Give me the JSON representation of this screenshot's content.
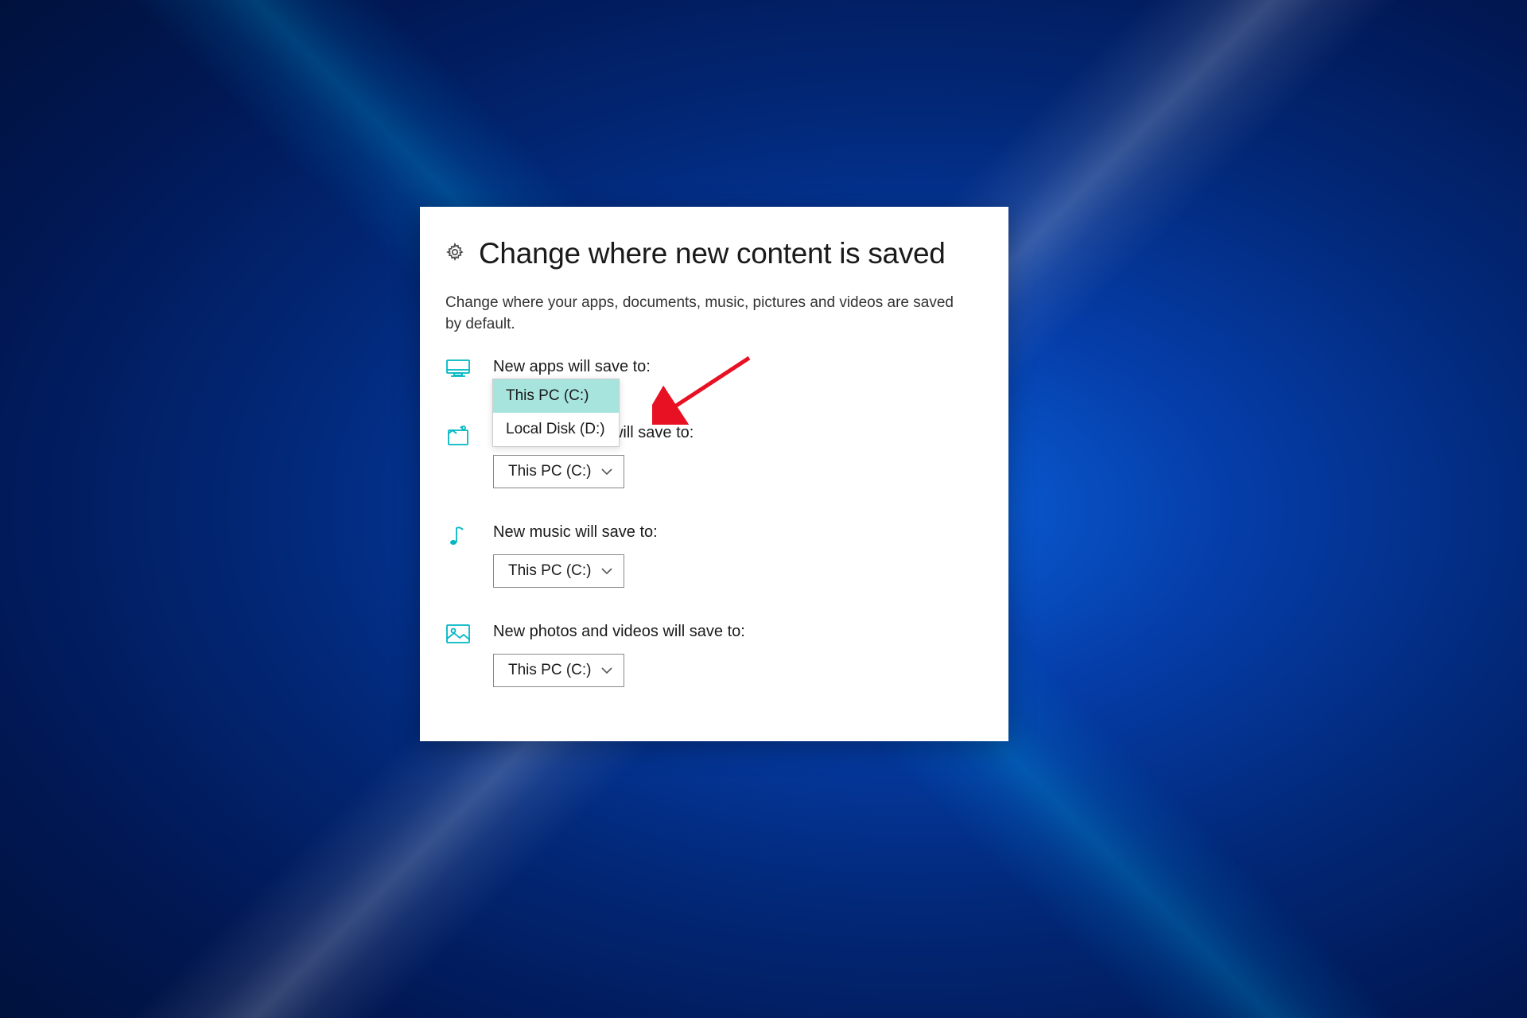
{
  "page": {
    "title": "Change where new content is saved",
    "description": "Change where your apps, documents, music, pictures and videos are saved by default."
  },
  "settings": {
    "apps": {
      "label": "New apps will save to:",
      "value": "This PC (C:)",
      "dropdown_open": true,
      "options": [
        "This PC (C:)",
        "Local Disk (D:)"
      ],
      "icon_color": "#00b7c3"
    },
    "documents": {
      "label": "New documents will save to:",
      "value": "This PC (C:)",
      "icon_color": "#00b7c3"
    },
    "music": {
      "label": "New music will save to:",
      "value": "This PC (C:)",
      "icon_color": "#00b7c3"
    },
    "photos": {
      "label": "New photos and videos will save to:",
      "value": "This PC (C:)",
      "icon_color": "#00b7c3"
    }
  },
  "colors": {
    "accent": "#00b7c3",
    "arrow": "#e81123"
  }
}
